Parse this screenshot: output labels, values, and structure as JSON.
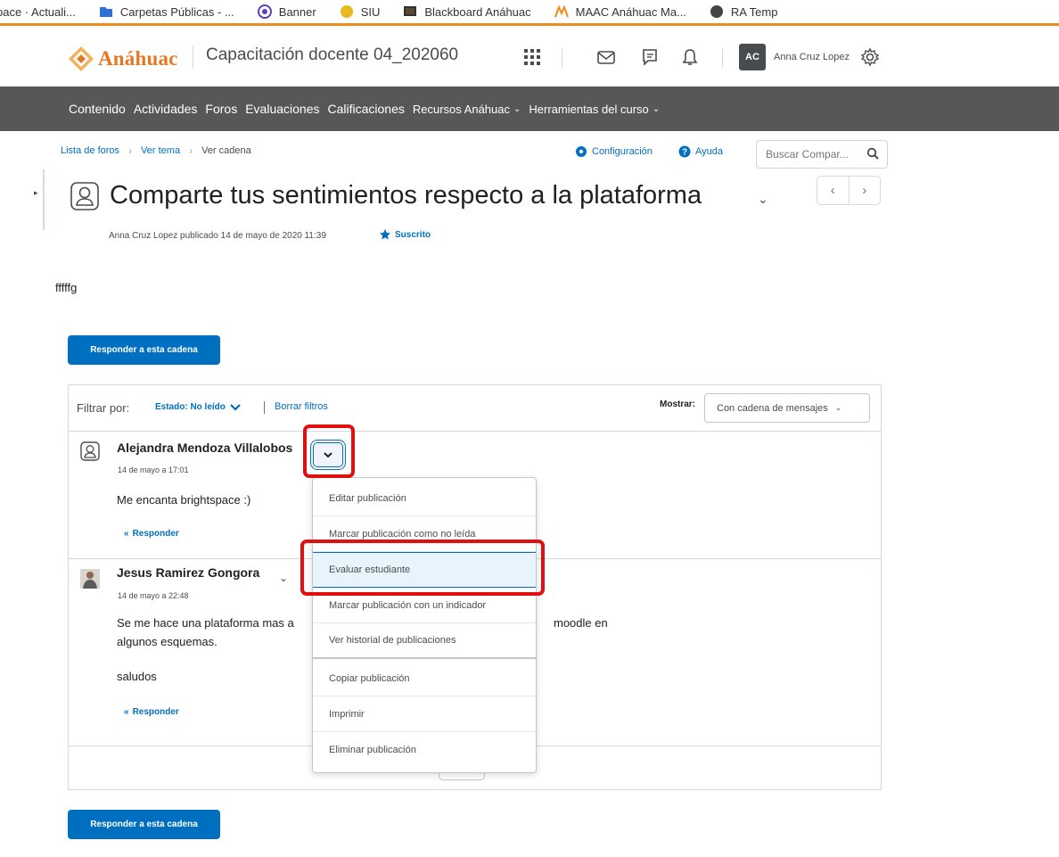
{
  "bookmarks": [
    {
      "label": "pace · Actuali...",
      "color": "#ffffff"
    },
    {
      "label": "Carpetas Públicas - ...",
      "color": "#2f6fd8"
    },
    {
      "label": "Banner",
      "color": "#5a3fc0"
    },
    {
      "label": "SIU",
      "color": "#e8b820"
    },
    {
      "label": "Blackboard Anáhuac",
      "color": "#333333"
    },
    {
      "label": "MAAC Anáhuac Ma...",
      "color": "#f08a1c"
    },
    {
      "label": "RA Temp",
      "color": "#444444"
    }
  ],
  "header": {
    "logo_text": "Anáhuac",
    "course_title": "Capacitación docente 04_202060",
    "user_initials": "AC",
    "user_name": "Anna Cruz Lopez",
    "icons": [
      "grid-icon",
      "mail-icon",
      "chat-icon",
      "bell-icon",
      "gear-icon"
    ]
  },
  "nav": {
    "items": [
      {
        "label": "Contenido",
        "has_menu": false
      },
      {
        "label": "Actividades",
        "has_menu": false
      },
      {
        "label": "Foros",
        "has_menu": false
      },
      {
        "label": "Evaluaciones",
        "has_menu": false
      },
      {
        "label": "Calificaciones",
        "has_menu": false
      },
      {
        "label": "Recursos Anáhuac",
        "has_menu": true
      },
      {
        "label": "Herramientas del curso",
        "has_menu": true
      }
    ]
  },
  "breadcrumb": {
    "items": [
      "Lista de foros",
      "Ver tema"
    ],
    "current": "Ver cadena"
  },
  "tools": {
    "settings": "Configuración",
    "help": "Ayuda",
    "search_placeholder": "Buscar Compar..."
  },
  "topic": {
    "title": "Comparte tus sentimientos respecto a la plataforma",
    "meta": "Anna Cruz Lopez publicado 14 de mayo de 2020 11:39",
    "subscribed": "Suscrito",
    "body": "fffffg"
  },
  "reply_button": "Responder a esta cadena",
  "filter": {
    "label": "Filtrar por:",
    "state": "Estado: No leído",
    "clear": "Borrar filtros",
    "show_label": "Mostrar:",
    "show_value": "Con cadena de mensajes"
  },
  "posts": [
    {
      "author": "Alejandra Mendoza Villalobos",
      "date": "14 de mayo a 17:01",
      "paragraphs": [
        "Me encanta brightspace :)"
      ],
      "reply": "Responder"
    },
    {
      "author": "Jesus Ramirez Gongora",
      "date": "14 de mayo a 22:48",
      "paragraphs": [
        "Se me hace una plataforma mas a",
        "moodle en",
        "algunos esquemas.",
        "saludos"
      ],
      "reply": "Responder"
    }
  ],
  "context_menu": {
    "items": [
      "Editar publicación",
      "Marcar publicación como no leída",
      "Evaluar estudiante",
      "Marcar publicación con un indicador",
      "Ver historial de publicaciones",
      "Copiar publicación",
      "Imprimir",
      "Eliminar publicación"
    ],
    "selected": "Evaluar estudiante"
  },
  "colors": {
    "accent": "#006fbf",
    "brand": "#e87722",
    "navbar": "#575757",
    "highlight": "#e01010"
  }
}
